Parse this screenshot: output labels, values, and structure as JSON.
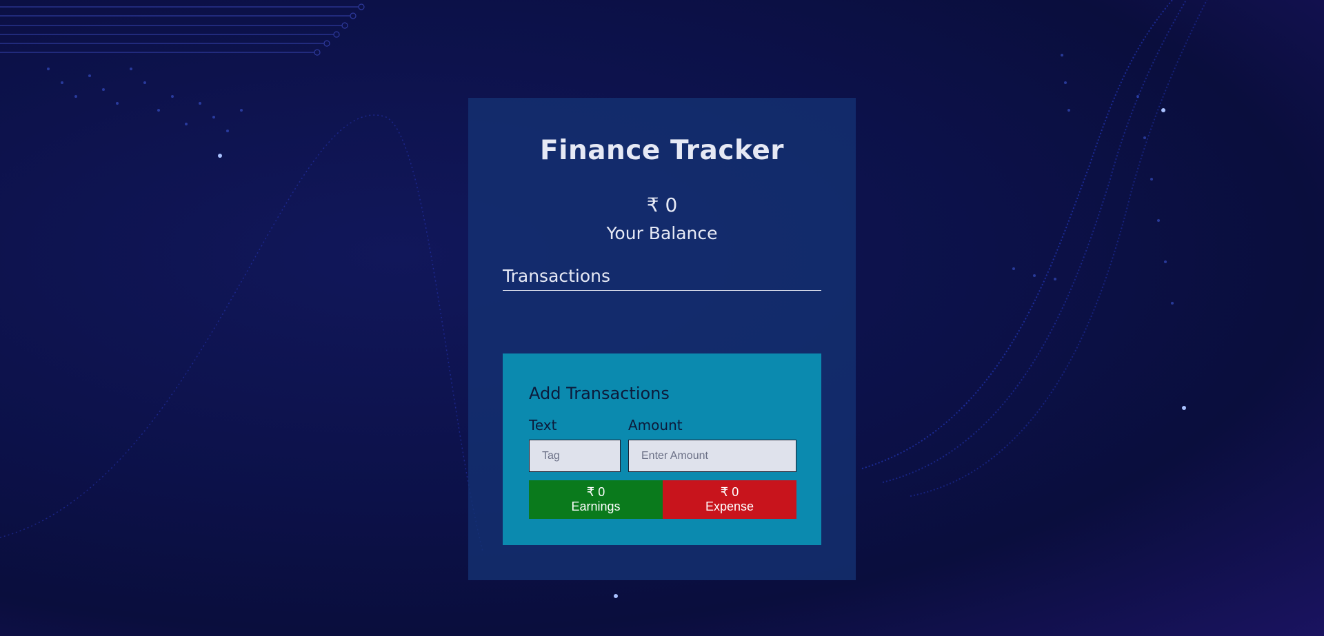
{
  "app": {
    "title": "Finance Tracker",
    "balance_amount": "₹ 0",
    "balance_label": "Your Balance",
    "transactions_heading": "Transactions"
  },
  "add_transaction": {
    "heading": "Add Transactions",
    "text_label": "Text",
    "amount_label": "Amount",
    "text_placeholder": "Tag",
    "amount_placeholder": "Enter Amount"
  },
  "summary": {
    "earnings_amount": "₹ 0",
    "earnings_label": "Earnings",
    "expense_amount": "₹ 0",
    "expense_label": "Expense"
  },
  "colors": {
    "background": "#0c1149",
    "card": "#143273",
    "panel": "#0aa0be",
    "earnings": "#0a7a1c",
    "expense": "#c8141c"
  }
}
